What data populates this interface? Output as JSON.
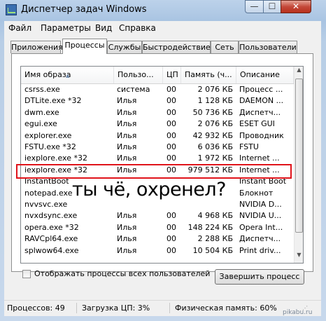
{
  "window": {
    "title": "Диспетчер задач Windows",
    "buttons": {
      "minimize": "—",
      "maximize": "☐",
      "close": "✕"
    }
  },
  "menu": [
    "Файл",
    "Параметры",
    "Вид",
    "Справка"
  ],
  "tabs": [
    {
      "label": "Приложения",
      "active": false
    },
    {
      "label": "Процессы",
      "active": true
    },
    {
      "label": "Службы",
      "active": false
    },
    {
      "label": "Быстродействие",
      "active": false
    },
    {
      "label": "Сеть",
      "active": false
    },
    {
      "label": "Пользователи",
      "active": false
    }
  ],
  "table": {
    "headers": [
      "Имя образа",
      "Пользо...",
      "ЦП",
      "Память (ч...",
      "Описание"
    ],
    "rows": [
      {
        "name": "csrss.exe",
        "user": "система",
        "cpu": "00",
        "mem": "2 076 КБ",
        "desc": "Процесс ..."
      },
      {
        "name": "DTLite.exe *32",
        "user": "Илья",
        "cpu": "00",
        "mem": "1 128 КБ",
        "desc": "DAEMON ..."
      },
      {
        "name": "dwm.exe",
        "user": "Илья",
        "cpu": "00",
        "mem": "50 736 КБ",
        "desc": "Диспетч..."
      },
      {
        "name": "egui.exe",
        "user": "Илья",
        "cpu": "00",
        "mem": "2 076 КБ",
        "desc": "ESET GUI"
      },
      {
        "name": "explorer.exe",
        "user": "Илья",
        "cpu": "00",
        "mem": "42 932 КБ",
        "desc": "Проводник"
      },
      {
        "name": "FSTU.exe *32",
        "user": "Илья",
        "cpu": "00",
        "mem": "6 036 КБ",
        "desc": "FSTU"
      },
      {
        "name": "iexplore.exe *32",
        "user": "Илья",
        "cpu": "00",
        "mem": "1 972 КБ",
        "desc": "Internet ..."
      },
      {
        "name": "iexplore.exe *32",
        "user": "Илья",
        "cpu": "00",
        "mem": "979 512 КБ",
        "desc": "Internet ..."
      },
      {
        "name": "InstantBoot",
        "user": "",
        "cpu": "",
        "mem": "",
        "desc": "Instant Boot"
      },
      {
        "name": "notepad.exe",
        "user": "",
        "cpu": "",
        "mem": "",
        "desc": "Блокнот"
      },
      {
        "name": "nvvsvc.exe",
        "user": "",
        "cpu": "",
        "mem": "",
        "desc": "NVIDIA D..."
      },
      {
        "name": "nvxdsync.exe",
        "user": "Илья",
        "cpu": "00",
        "mem": "4 968 КБ",
        "desc": "NVIDIA U..."
      },
      {
        "name": "opera.exe *32",
        "user": "Илья",
        "cpu": "00",
        "mem": "148 224 КБ",
        "desc": "Opera Int..."
      },
      {
        "name": "RAVCpl64.exe",
        "user": "Илья",
        "cpu": "00",
        "mem": "2 288 КБ",
        "desc": "Диспетч..."
      },
      {
        "name": "splwow64.exe",
        "user": "Илья",
        "cpu": "00",
        "mem": "10 504 КБ",
        "desc": "Print driv..."
      }
    ]
  },
  "meme_text": "ты чё, охренел?",
  "show_all_label": "Отображать процессы всех пользователей",
  "end_process_label": "Завершить процесс",
  "status": {
    "processes": "Процессов: 49",
    "cpu": "Загрузка ЦП: 3%",
    "memory": "Физическая память: 60%"
  },
  "watermark": "pikabu.ru"
}
